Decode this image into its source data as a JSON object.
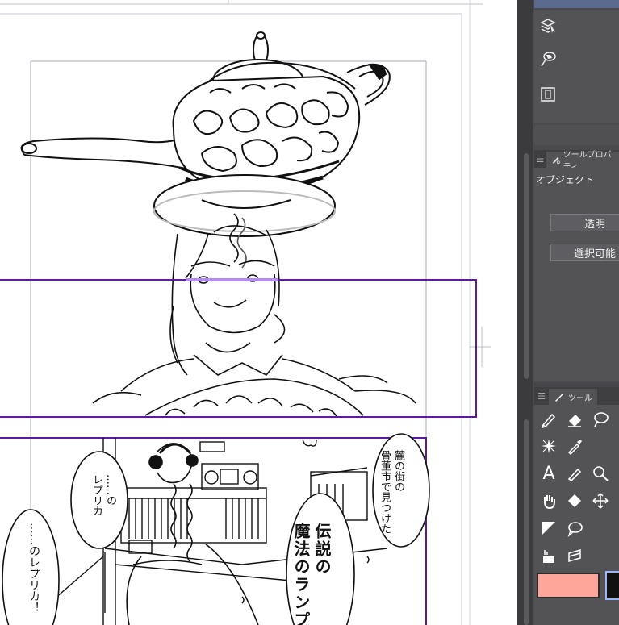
{
  "panel": {
    "property_title": "ツールプロパティ",
    "object_label": "オブジェクト",
    "btn_transparent": "透明",
    "btn_selectable": "選択可能",
    "tool_title": "ツール",
    "colors": {
      "main": "#ffa69a",
      "sub": "#111111",
      "panel_bg": "#4a4a4e"
    }
  },
  "manga": {
    "panel_frame_color": "#5b1aa0",
    "bubble_right": [
      "麓の街の",
      "骨董市で見つけた"
    ],
    "bubble_center": [
      "伝説の",
      "魔法のランプ"
    ],
    "bubble_left": [
      "……の",
      "レプリカ"
    ],
    "bubble_far_left": "……のレプリカ！"
  }
}
